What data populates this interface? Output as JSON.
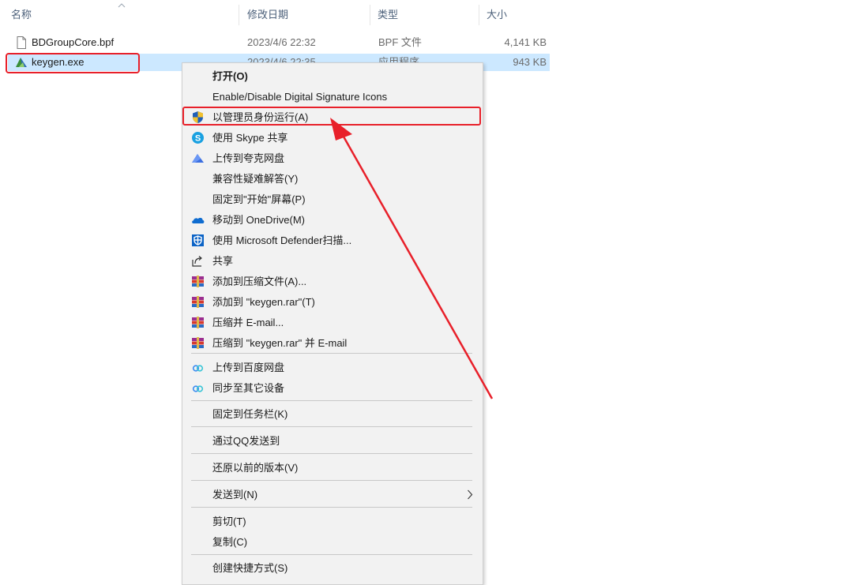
{
  "columns": {
    "name": "名称",
    "modified": "修改日期",
    "type": "类型",
    "size": "大小"
  },
  "files": [
    {
      "name": "BDGroupCore.bpf",
      "date": "2023/4/6 22:32",
      "type": "BPF 文件",
      "size": "4,141 KB",
      "icon": "document-icon"
    },
    {
      "name": "keygen.exe",
      "date": "2023/4/6 22:35",
      "type": "应用程序",
      "size": "943 KB",
      "icon": "keygen-app-icon",
      "selected": true
    }
  ],
  "context_menu": {
    "items": [
      {
        "label": "打开(O)",
        "icon": null,
        "bold": true
      },
      {
        "label": "Enable/Disable Digital Signature Icons",
        "icon": null
      },
      {
        "label": "以管理员身份运行(A)",
        "icon": "uac-shield-icon"
      },
      {
        "label": "使用 Skype 共享",
        "icon": "skype-icon"
      },
      {
        "label": "上传到夸克网盘",
        "icon": "quark-cloud-icon"
      },
      {
        "label": "兼容性疑难解答(Y)",
        "icon": null
      },
      {
        "label": "固定到\"开始\"屏幕(P)",
        "icon": null
      },
      {
        "label": "移动到 OneDrive(M)",
        "icon": "onedrive-icon"
      },
      {
        "label": "使用 Microsoft Defender扫描...",
        "icon": "defender-icon"
      },
      {
        "label": "共享",
        "icon": "share-icon"
      },
      {
        "label": "添加到压缩文件(A)...",
        "icon": "winrar-icon"
      },
      {
        "label": "添加到 \"keygen.rar\"(T)",
        "icon": "winrar-icon"
      },
      {
        "label": "压缩并 E-mail...",
        "icon": "winrar-icon"
      },
      {
        "label": "压缩到 \"keygen.rar\" 并 E-mail",
        "icon": "winrar-icon"
      },
      {
        "label": "上传到百度网盘",
        "icon": "baidu-netdisk-icon"
      },
      {
        "label": "同步至其它设备",
        "icon": "baidu-netdisk-icon"
      },
      {
        "label": "固定到任务栏(K)",
        "icon": null
      },
      {
        "label": "通过QQ发送到",
        "icon": null
      },
      {
        "label": "还原以前的版本(V)",
        "icon": null
      },
      {
        "label": "发送到(N)",
        "icon": null,
        "submenu": true
      },
      {
        "label": "剪切(T)",
        "icon": null
      },
      {
        "label": "复制(C)",
        "icon": null
      },
      {
        "label": "创建快捷方式(S)",
        "icon": null
      }
    ]
  },
  "annotation": {
    "highlight_color": "#e8202a",
    "highlighted_file": "keygen.exe",
    "highlighted_menu_item": "以管理员身份运行(A)"
  },
  "colors": {
    "selection": "#cce8ff",
    "menu_bg": "#f2f2f2",
    "header_text": "#4c607a"
  }
}
